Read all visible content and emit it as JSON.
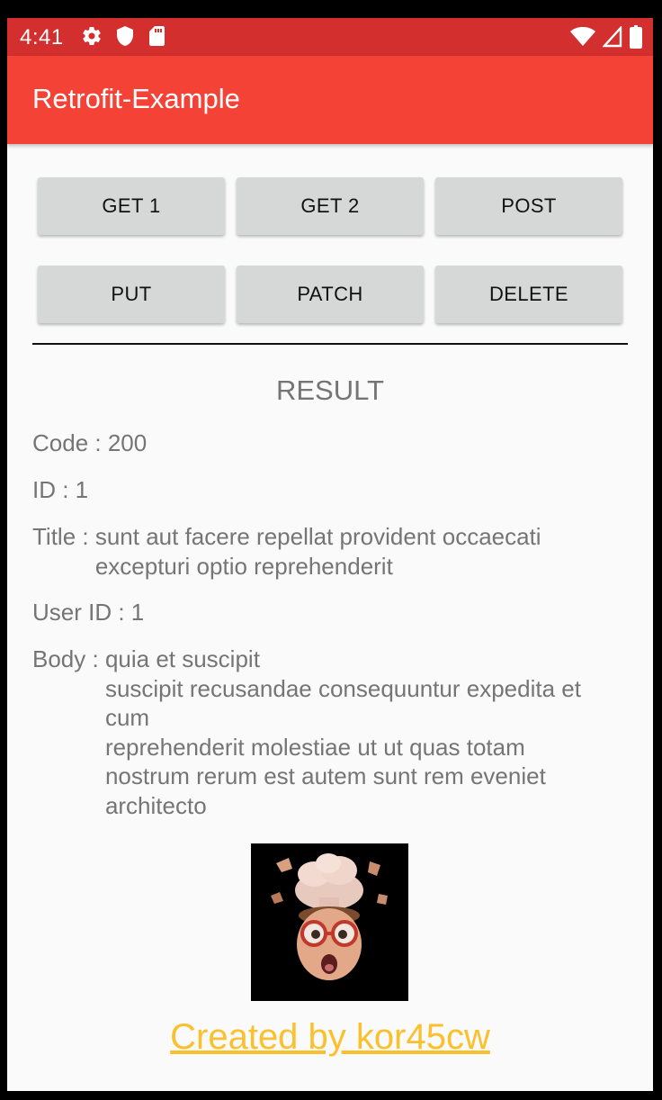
{
  "status_bar": {
    "time": "4:41",
    "color": "#d32f2f",
    "left_icons": [
      "settings-icon",
      "shield-icon",
      "sd-card-icon"
    ],
    "right_icons": [
      "wifi-icon",
      "signal-icon",
      "battery-icon"
    ]
  },
  "app_bar": {
    "title": "Retrofit-Example",
    "color": "#f44336"
  },
  "buttons": [
    "GET 1",
    "GET 2",
    "POST",
    "PUT",
    "PATCH",
    "DELETE"
  ],
  "result": {
    "heading": "RESULT",
    "code_label": "Code : ",
    "code_value": "200",
    "id_label": "ID : ",
    "id_value": "1",
    "title_label": "Title : ",
    "title_value": "sunt aut facere repellat provident occaecati\nexcepturi optio reprehenderit",
    "user_id_label": "User ID : ",
    "user_id_value": "1",
    "body_label": "Body : ",
    "body_value": "quia et suscipit\nsuscipit recusandae consequuntur expedita et\ncum\nreprehenderit molestiae ut ut quas totam\nnostrum rerum est autem sunt rem eveniet\narchitecto"
  },
  "footer": {
    "link_text": "Created by kor45cw",
    "color": "#fbc02d"
  }
}
